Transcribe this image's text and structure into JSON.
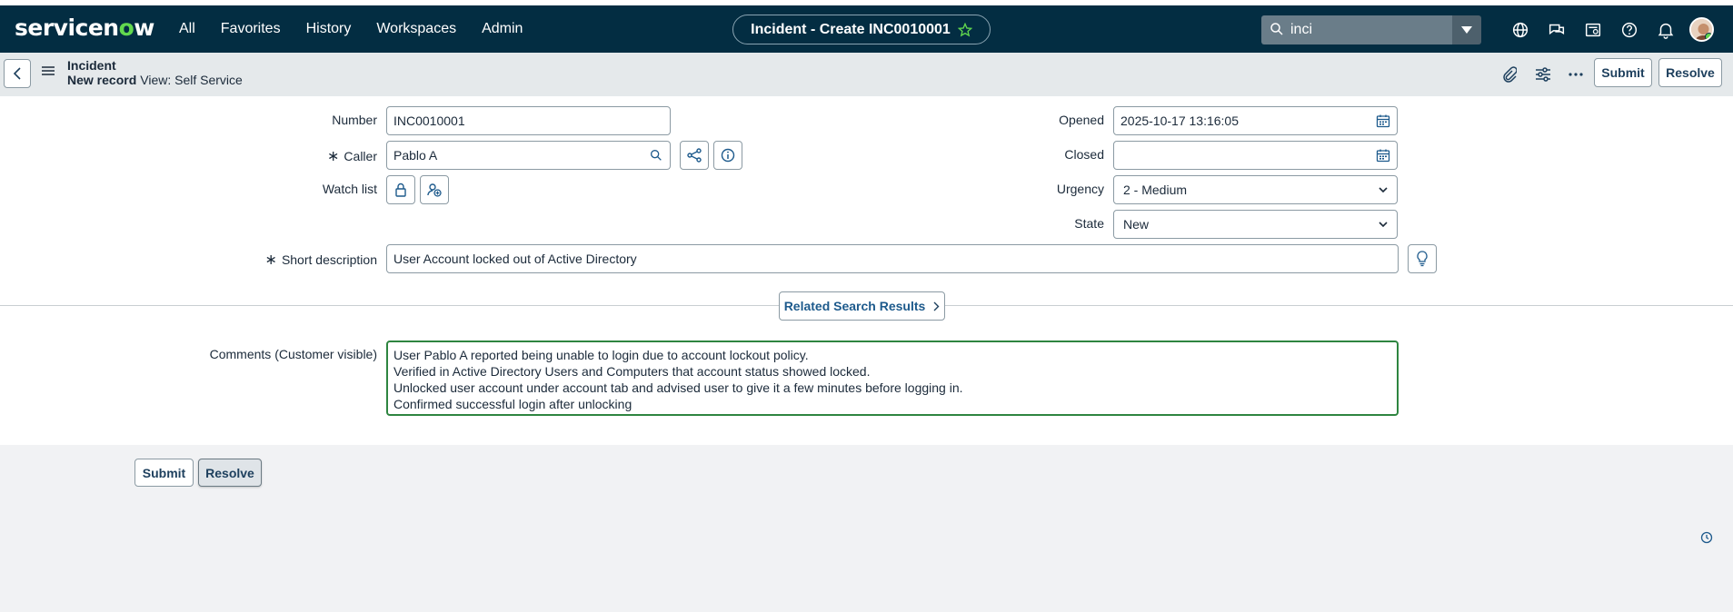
{
  "nav": {
    "logo_before": "servicen",
    "logo_o": "o",
    "logo_after": "w",
    "menu": [
      "All",
      "Favorites",
      "History",
      "Workspaces",
      "Admin"
    ],
    "record_pill": "Incident - Create INC0010001",
    "search_value": "inci",
    "icons": [
      "globe-icon",
      "chat-icon",
      "inbox-icon",
      "help-icon",
      "bell-icon"
    ]
  },
  "header": {
    "table": "Incident",
    "record": "New record",
    "view": "View: Self Service",
    "submit_label": "Submit",
    "resolve_label": "Resolve"
  },
  "form": {
    "number_label": "Number",
    "number_value": "INC0010001",
    "caller_label": "Caller",
    "caller_value": "Pablo  A",
    "watchlist_label": "Watch list",
    "opened_label": "Opened",
    "opened_value": "2025-10-17 13:16:05",
    "closed_label": "Closed",
    "closed_value": "",
    "urgency_label": "Urgency",
    "urgency_value": "2 - Medium",
    "state_label": "State",
    "state_value": "New",
    "short_desc_label": "Short description",
    "short_desc_value": "User Account locked out of Active Directory",
    "related_label": "Related Search Results",
    "comments_label": "Comments (Customer visible)",
    "comments_value": "User Pablo A reported being unable to login due to account lockout policy.\nVerified in Active Directory Users and Computers that account status showed locked.\nUnlocked user account under account tab and advised user to give it a few minutes before logging in.\nConfirmed successful login after unlocking"
  },
  "footer": {
    "submit_label": "Submit",
    "resolve_label": "Resolve"
  },
  "colors": {
    "nav_bg": "#032d42",
    "accent_green": "#62d84e",
    "focus_green": "#2e8540",
    "link_blue": "#1d5a8c"
  }
}
